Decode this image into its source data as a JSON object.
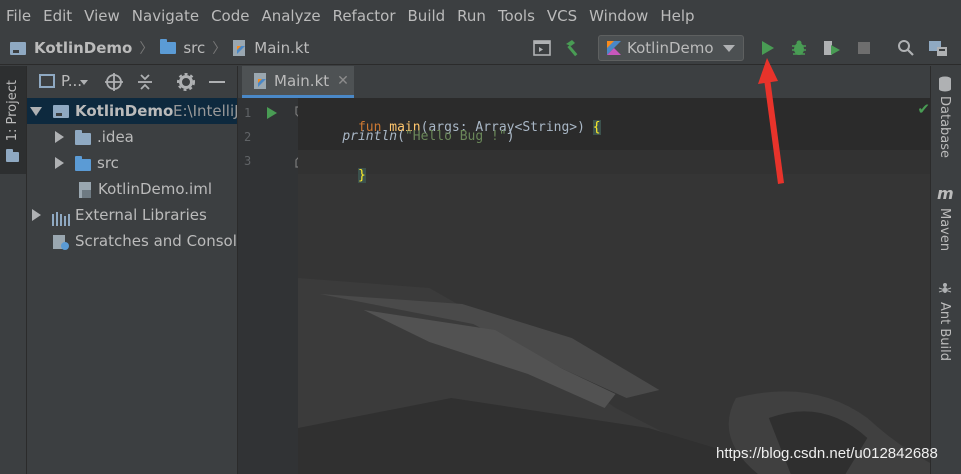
{
  "menu": [
    {
      "label": "File"
    },
    {
      "label": "Edit"
    },
    {
      "label": "View"
    },
    {
      "label": "Navigate"
    },
    {
      "label": "Code"
    },
    {
      "label": "Analyze"
    },
    {
      "label": "Refactor"
    },
    {
      "label": "Build"
    },
    {
      "label": "Run"
    },
    {
      "label": "Tools"
    },
    {
      "label": "VCS"
    },
    {
      "label": "Window"
    },
    {
      "label": "Help"
    }
  ],
  "breadcrumb": {
    "project": "KotlinDemo",
    "folder": "src",
    "file": "Main.kt"
  },
  "run_config": {
    "label": "KotlinDemo"
  },
  "left_strip": {
    "project_tab": "1: Project"
  },
  "project_panel": {
    "view_label": "P..."
  },
  "tree": [
    {
      "label": "KotlinDemo",
      "path": "E:\\IntelliJ"
    },
    {
      "label": ".idea"
    },
    {
      "label": "src"
    },
    {
      "label": "KotlinDemo.iml"
    },
    {
      "label": "External Libraries"
    },
    {
      "label": "Scratches and Consoles"
    }
  ],
  "editor": {
    "tab_label": "Main.kt",
    "line_numbers": [
      "1",
      "2",
      "3"
    ],
    "lines": {
      "l1_kw": "fun",
      "l1_fn": "main",
      "l1_rest": "(args: Array<String>) ",
      "l1_brace": "{",
      "l2_call": "println",
      "l2_open": "(",
      "l2_str": "\"Hello Bug !\"",
      "l2_close": ")",
      "l3": "}"
    }
  },
  "right_strip": {
    "database": "Database",
    "maven": "Maven",
    "ant": "Ant Build"
  },
  "watermark": "https://blog.csdn.net/u012842688",
  "colors": {
    "accent": "#4a88c7",
    "run_green": "#499c54",
    "arrow_red": "#e8332b",
    "selection": "#0d293e"
  }
}
